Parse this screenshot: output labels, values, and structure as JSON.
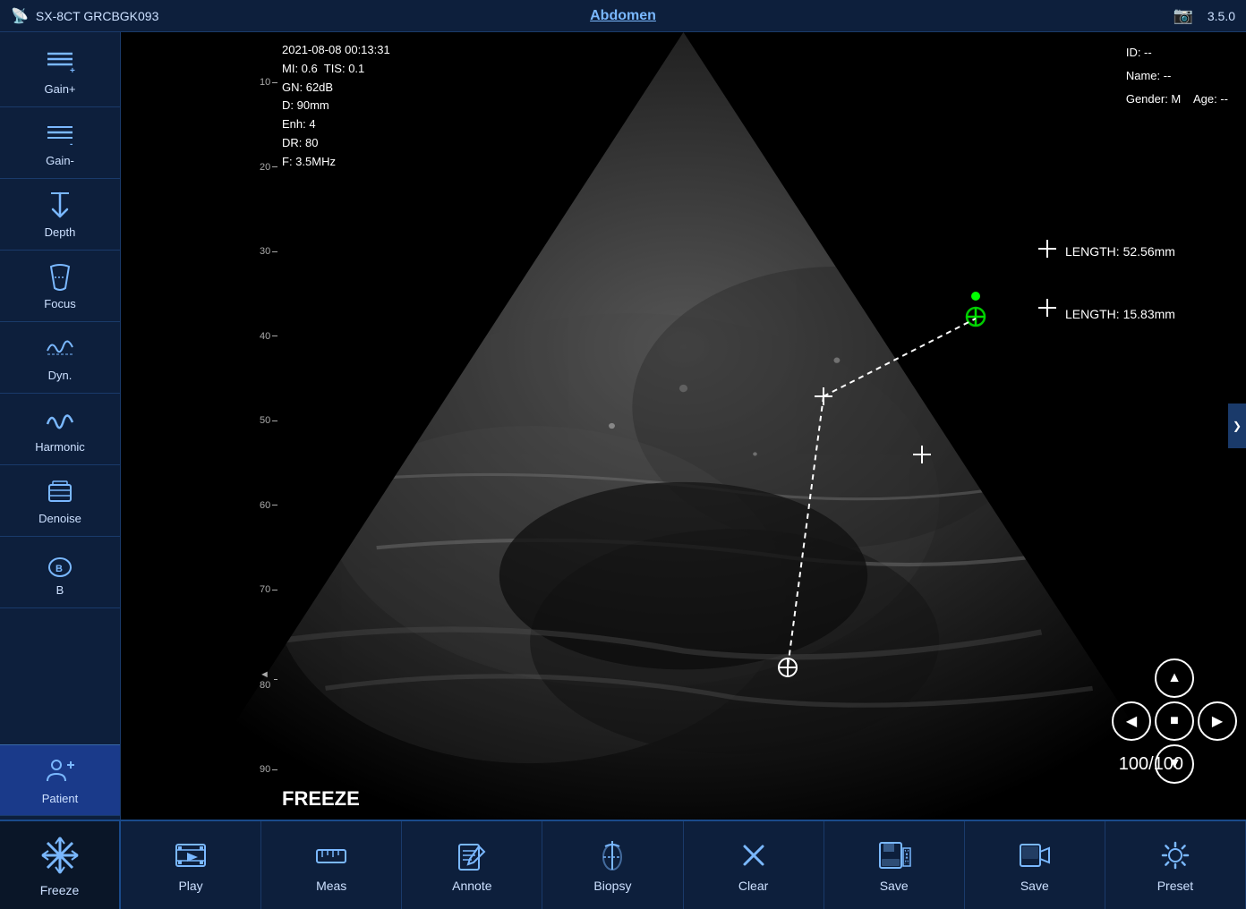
{
  "topbar": {
    "probe": "SX-8CT GRCBGK093",
    "exam_type": "Abdomen",
    "version": "3.5.0"
  },
  "overlay": {
    "datetime": "2021-08-08 00:13:31",
    "mi": "MI: 0.6",
    "tis": "TIS: 0.1",
    "gn": "GN: 62dB",
    "depth": "D: 90mm",
    "enh": "Enh: 4",
    "dr": "DR: 80",
    "freq": "F: 3.5MHz"
  },
  "patient": {
    "id": "ID: --",
    "name": "Name: --",
    "gender": "Gender: M",
    "age": "Age: --"
  },
  "measurements": {
    "length1_label": "LENGTH: 52.56mm",
    "length2_label": "LENGTH: 15.83mm"
  },
  "status": {
    "freeze": "FREEZE",
    "frame": "100/100"
  },
  "sidebar": {
    "items": [
      {
        "label": "Gain+",
        "icon": "gain-plus"
      },
      {
        "label": "Gain-",
        "icon": "gain-minus"
      },
      {
        "label": "Depth",
        "icon": "depth"
      },
      {
        "label": "Focus",
        "icon": "focus"
      },
      {
        "label": "Dyn.",
        "icon": "dynamic"
      },
      {
        "label": "Harmonic",
        "icon": "harmonic"
      },
      {
        "label": "Denoise",
        "icon": "denoise"
      },
      {
        "label": "B",
        "icon": "b-mode"
      },
      {
        "label": "Patient",
        "icon": "patient"
      }
    ]
  },
  "toolbar": {
    "freeze_label": "Freeze",
    "play_label": "Play",
    "meas_label": "Meas",
    "annote_label": "Annote",
    "biopsy_label": "Biopsy",
    "clear_label": "Clear",
    "save1_label": "Save",
    "save2_label": "Save",
    "preset_label": "Preset"
  },
  "depth_marks": [
    "10",
    "20",
    "30",
    "40",
    "50",
    "60",
    "70",
    "80",
    "90"
  ]
}
